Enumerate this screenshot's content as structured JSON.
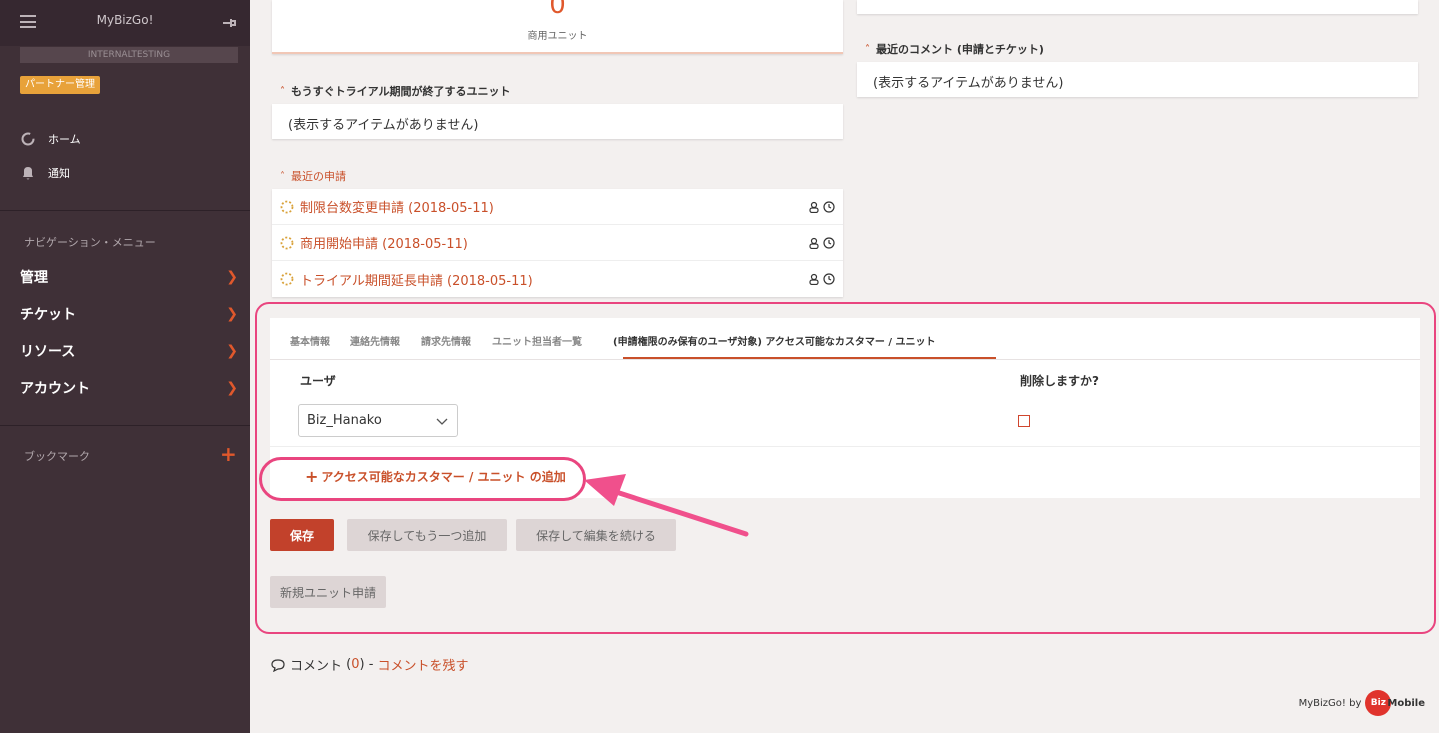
{
  "sidebar": {
    "app_title": "MyBizGo!",
    "tenant": "INTERNALTESTING",
    "partner_badge": "パートナー管理",
    "links": [
      {
        "label": "ホーム",
        "icon": "circle-icon"
      },
      {
        "label": "通知",
        "icon": "bell-icon"
      }
    ],
    "nav_heading": "ナビゲーション・メニュー",
    "nav_items": [
      {
        "label": "管理"
      },
      {
        "label": "チケット"
      },
      {
        "label": "リソース"
      },
      {
        "label": "アカウント"
      }
    ],
    "bookmark_heading": "ブックマーク",
    "bookmark_add": "+",
    "colors": {
      "bg": "#3f3037",
      "accent": "#e0582c",
      "badge": "#e8a23a"
    }
  },
  "main": {
    "top_card": {
      "count": "0",
      "label": "商用ユニット"
    },
    "trial_section": {
      "heading": "もうすぐトライアル期間が終了するユニット",
      "empty": "(表示するアイテムがありません)"
    },
    "comments_section": {
      "heading": "最近のコメント (申請とチケット)",
      "empty": "(表示するアイテムがありません)"
    },
    "recent_requests": {
      "heading": "最近の申請",
      "items": [
        {
          "label": "制限台数変更申請 (2018-05-11)"
        },
        {
          "label": "商用開始申請 (2018-05-11)"
        },
        {
          "label": "トライアル期間延長申請 (2018-05-11)"
        }
      ]
    },
    "tabs": [
      {
        "label": "基本情報"
      },
      {
        "label": "連絡先情報"
      },
      {
        "label": "請求先情報"
      },
      {
        "label": "ユニット担当者一覧"
      },
      {
        "label": "(申請権限のみ保有のユーザ対象) アクセス可能なカスタマー / ユニット",
        "active": true
      }
    ],
    "form": {
      "col_user": "ユーザ",
      "col_delete": "削除しますか?",
      "selected_user": "Biz_Hanako",
      "add_link": "アクセス可能なカスタマー / ユニット の追加"
    },
    "buttons": {
      "save": "保存",
      "save_add": "保存してもう一つ追加",
      "save_continue": "保存して編集を続ける",
      "new_unit": "新規ユニット申請"
    },
    "comments": {
      "label": "コメント",
      "open": " (",
      "count": "0",
      "close": ") - ",
      "leave": "コメントを残す"
    },
    "footer": {
      "text": "MyBizGo! by",
      "logo_a": "Biz",
      "logo_b": "Mobile"
    },
    "colors": {
      "accent": "#c9502a",
      "highlight": "#e9457f",
      "primary_button": "#c2412b"
    }
  }
}
